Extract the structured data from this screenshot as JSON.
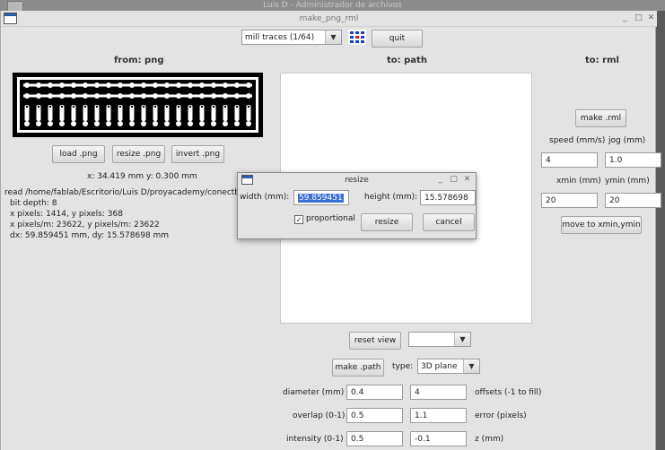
{
  "background_window": {
    "title": "Luis D - Administrador de archivos"
  },
  "window": {
    "title": "make_png_rml",
    "controls": {
      "minimize": "_",
      "maximize": "□",
      "close": "✕"
    }
  },
  "toolbar": {
    "mode_select": "mill traces (1/64)",
    "quit_label": "quit"
  },
  "from_panel": {
    "heading": "from: png",
    "buttons": {
      "load": "load .png",
      "resize": "resize .png",
      "invert": "invert .png"
    },
    "coords": "x: 34.419 mm  y: 0.300 mm",
    "info": [
      "read /home/fablab/Escritorio/Luis D/proyacademy/conectboa",
      "bit depth: 8",
      "x pixels: 1414, y pixels: 368",
      "x pixels/m: 23622, y pixels/m: 23622",
      "dx: 59.859451 mm, dy: 15.578698 mm"
    ]
  },
  "path_panel": {
    "heading": "to: path",
    "reset_view": "reset view",
    "make_path": "make .path",
    "type_label": "type:",
    "type_value": "3D plane",
    "params": [
      {
        "label": "diameter (mm)",
        "v1": "0.4",
        "v2": "4",
        "label2": "offsets (-1 to fill)"
      },
      {
        "label": "overlap (0-1)",
        "v1": "0.5",
        "v2": "1.1",
        "label2": "error (pixels)"
      },
      {
        "label": "intensity (0-1)",
        "v1": "0.5",
        "v2": "-0.1",
        "label2": "z (mm)"
      }
    ]
  },
  "rml_panel": {
    "heading": "to: rml",
    "make_rml": "make .rml",
    "speed_label": "speed (mm/s)",
    "jog_label": "jog (mm)",
    "speed_value": "4",
    "jog_value": "1.0",
    "xmin_label": "xmin (mm)",
    "ymin_label": "ymin (mm)",
    "xmin_value": "20",
    "ymin_value": "20",
    "move_label": "move to xmin,ymin"
  },
  "resize_dialog": {
    "title": "resize",
    "width_label": "width (mm):",
    "width_value": "59.859451",
    "height_label": "height (mm):",
    "height_value": "15.578698",
    "proportional_label": "proportional",
    "proportional_checked": true,
    "resize_label": "resize",
    "cancel_label": "cancel"
  }
}
